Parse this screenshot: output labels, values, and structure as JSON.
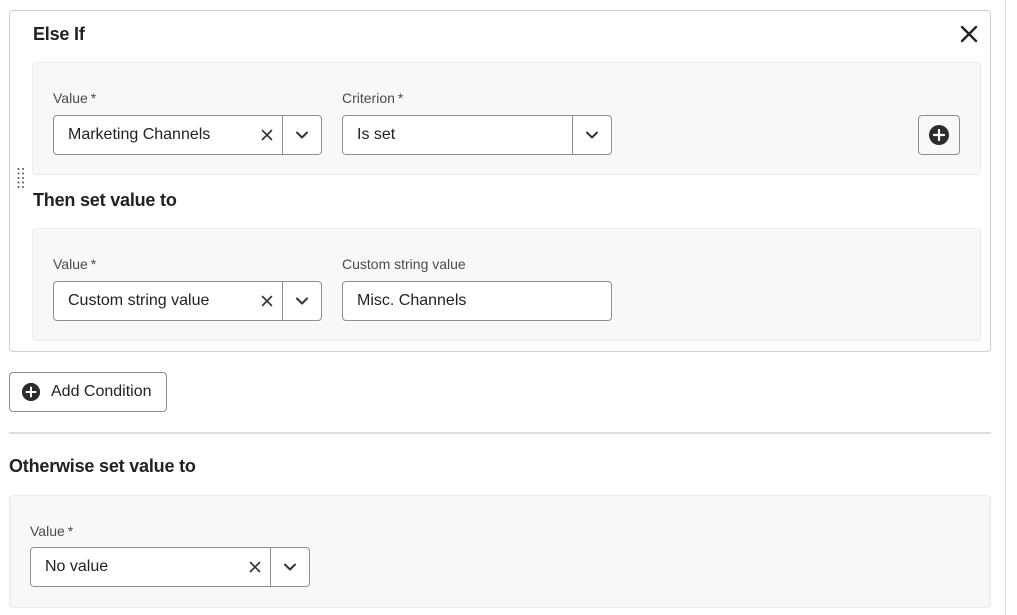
{
  "else_if": {
    "title": "Else If",
    "condition": {
      "value_label": "Value",
      "value_selected": "Marketing Channels",
      "criterion_label": "Criterion",
      "criterion_selected": "Is set"
    },
    "then": {
      "title": "Then set value to",
      "value_label": "Value",
      "value_selected": "Custom string value",
      "custom_label": "Custom string value",
      "custom_value": "Misc. Channels"
    }
  },
  "add_condition_label": "Add Condition",
  "otherwise": {
    "title": "Otherwise set value to",
    "value_label": "Value",
    "value_selected": "No value"
  },
  "icons": {
    "close": "close-icon",
    "clear": "clear-icon",
    "chevron": "chevron-down-icon",
    "add": "add-circle-icon",
    "drag": "drag-handle-icon"
  },
  "colors": {
    "text": "#222222",
    "border": "#8f8f8f",
    "panel_bg": "#f8f8f8"
  }
}
